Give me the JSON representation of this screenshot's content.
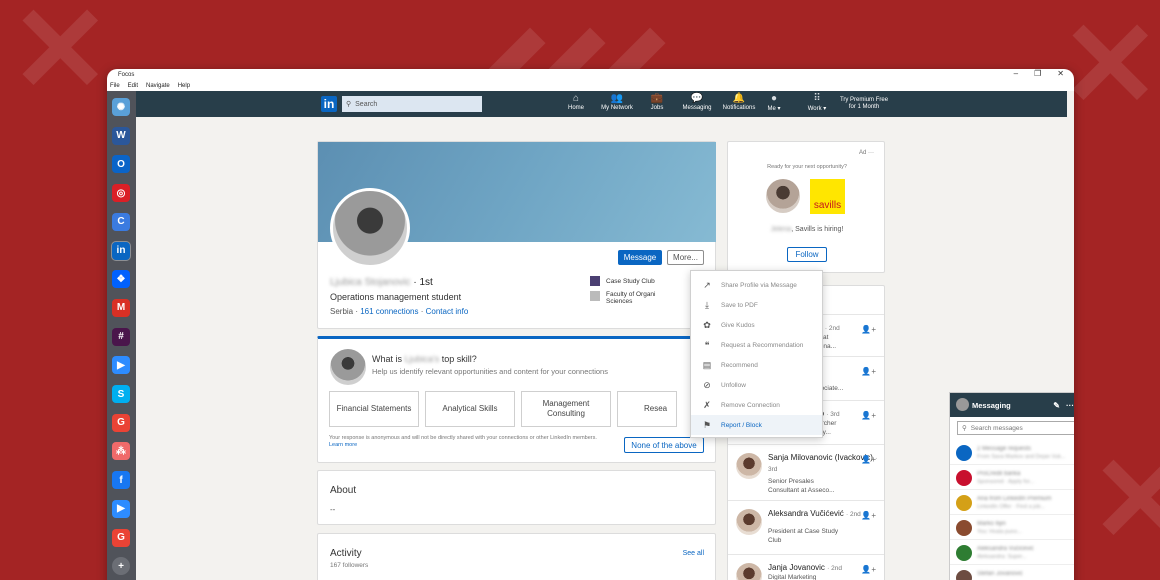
{
  "window": {
    "title": "Focos",
    "controls": [
      "–",
      "❐",
      "✕"
    ]
  },
  "menu": [
    "File",
    "Edit",
    "Navigate",
    "Help"
  ],
  "dock": [
    {
      "icon": "focos-icon",
      "glyph": "✺",
      "color": "#5aa0d8"
    },
    {
      "icon": "word-icon",
      "glyph": "W",
      "color": "#2b579a"
    },
    {
      "icon": "outlook-icon",
      "glyph": "O",
      "color": "#0a64c8"
    },
    {
      "icon": "creative-cloud-icon",
      "glyph": "◎",
      "color": "#da1f26"
    },
    {
      "icon": "cortana-icon",
      "glyph": "C",
      "color": "#3b7be0"
    },
    {
      "icon": "linkedin-icon",
      "glyph": "in",
      "color": "#0a66c2"
    },
    {
      "icon": "dropbox-icon",
      "glyph": "❖",
      "color": "#0061fe"
    },
    {
      "icon": "gmail-icon",
      "glyph": "M",
      "color": "#d93025"
    },
    {
      "icon": "slack-icon",
      "glyph": "#",
      "color": "#4a154b"
    },
    {
      "icon": "zoom-icon",
      "glyph": "▶",
      "color": "#2d8cff"
    },
    {
      "icon": "skype-icon",
      "glyph": "S",
      "color": "#00aff0"
    },
    {
      "icon": "google-icon",
      "glyph": "G",
      "color": "#ea4335"
    },
    {
      "icon": "asana-icon",
      "glyph": "⁂",
      "color": "#f06a6a"
    },
    {
      "icon": "facebook-icon",
      "glyph": "f",
      "color": "#1877f2"
    },
    {
      "icon": "zoom-icon",
      "glyph": "▶",
      "color": "#2d8cff"
    },
    {
      "icon": "google-icon",
      "glyph": "G",
      "color": "#ea4335"
    },
    {
      "icon": "add-icon",
      "glyph": "+",
      "color": "#6b6e75"
    }
  ],
  "nav": {
    "search_placeholder": "Search",
    "items": [
      {
        "label": "Home",
        "icon": "⌂"
      },
      {
        "label": "My Network",
        "icon": "👥"
      },
      {
        "label": "Jobs",
        "icon": "💼"
      },
      {
        "label": "Messaging",
        "icon": "💬"
      },
      {
        "label": "Notifications",
        "icon": "🔔"
      },
      {
        "label": "Me ▾",
        "icon": "●"
      },
      {
        "label": "Work ▾",
        "icon": "⠿"
      }
    ],
    "premium": "Try Premium Free for 1 Month"
  },
  "profile": {
    "name": "Ljubica Stojanovic",
    "degree": "· 1st",
    "headline": "Operations management student",
    "location": "Serbia",
    "connections": "161 connections",
    "contact": "Contact info",
    "message_btn": "Message",
    "more_btn": "More...",
    "edu1": "Case Study Club",
    "edu2": "Faculty of Organi",
    "edu2b": "Sciences"
  },
  "dropdown": [
    {
      "label": "Share Profile via Message",
      "icon": "↗"
    },
    {
      "label": "Save to PDF",
      "icon": "⤓"
    },
    {
      "label": "Give Kudos",
      "icon": "✿"
    },
    {
      "label": "Request a Recommendation",
      "icon": "❝"
    },
    {
      "label": "Recommend",
      "icon": "▤"
    },
    {
      "label": "Unfollow",
      "icon": "⊘"
    },
    {
      "label": "Remove Connection",
      "icon": "✗"
    },
    {
      "label": "Report / Block",
      "icon": "⚑"
    }
  ],
  "skill_card": {
    "question_pre": "What is",
    "question_name": "Ljubica's",
    "question_post": "top skill?",
    "subtitle": "Help us identify relevant opportunities and content for your connections",
    "skills": [
      "Financial Statements",
      "Analytical Skills",
      "Management Consulting",
      "Resea"
    ],
    "note": "Your response is anonymous and will not be directly shared with your connections or other LinkedIn members.",
    "learn_more": "Learn more",
    "none_btn": "None of the above"
  },
  "about": {
    "title": "About",
    "text": "--"
  },
  "activity": {
    "title": "Activity",
    "followers": "167 followers",
    "see_all": "See all"
  },
  "ad": {
    "label": "Ad",
    "more": "···",
    "tagline": "Ready for your next opportunity?",
    "brand": "savills",
    "hiring_name": "Jelena",
    "hiring_text": ", Savills is hiring!",
    "follow": "Follow"
  },
  "people": {
    "header": "ved",
    "list": [
      {
        "name": "Milinkovic",
        "degree": "· 2nd",
        "desc1": "g Associate at",
        "desc2": "f organizationa..."
      },
      {
        "name": "elap",
        "degree": "· 2nd",
        "desc1": "Operations",
        "desc2": "se (HR Associate..."
      },
      {
        "name": "a Bundalo",
        "degree": "· 3rd",
        "desc1": "Plan Researcher",
        "desc2": "er at Journey..."
      },
      {
        "name": "Sanja Milovanovic (Ivackovic)",
        "degree": "· 3rd",
        "desc1": "Senior Presales",
        "desc2": "Consultant at Asseco..."
      },
      {
        "name": "Aleksandra Vučićević",
        "degree": "· 2nd",
        "desc1": "President at Case Study",
        "desc2": "Club"
      },
      {
        "name": "Janja Jovanovic",
        "degree": "· 2nd",
        "desc1": "Digital Marketing",
        "desc2": ""
      }
    ]
  },
  "messaging": {
    "title": "Messaging",
    "search_placeholder": "Search messages",
    "rows": [
      {
        "l1": "2 Message requests",
        "l2": "From Sava Markov and Dejan Vuk..."
      },
      {
        "l1": "ProCredit banka",
        "l2": "Sponsored · Apply for..."
      },
      {
        "l1": "Ana from LinkedIn Premium",
        "l2": "LinkedIn Offer · Find a job..."
      },
      {
        "l1": "Marko Ilijin",
        "l2": "You: Hvala puno..."
      },
      {
        "l1": "Aleksandra Vučićević",
        "l2": "Aleksandra: Super..."
      },
      {
        "l1": "Stefan Jovanović",
        "l2": "..."
      }
    ]
  }
}
